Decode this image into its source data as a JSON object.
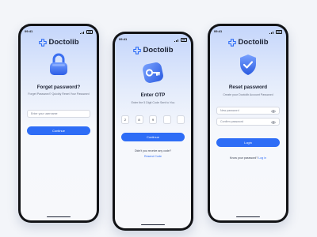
{
  "status_time": "09:41",
  "brand": {
    "name": "Doctolib",
    "color": "#2e6df6"
  },
  "screen_forgot": {
    "illustration": "lock-icon",
    "title": "Forget password?",
    "subtitle": "Forget Password? Quickly Reset Your Password",
    "username_placeholder": "Enter your username",
    "button": "Continue"
  },
  "screen_otp": {
    "illustration": "key-icon",
    "title": "Enter OTP",
    "subtitle": "Enter the 5 Digit Code Sent to You",
    "digits": [
      "2",
      "8",
      "9",
      "",
      ""
    ],
    "button": "Continue",
    "resend_prompt": "Didn't you receive any code?",
    "resend_link": "Resend Code"
  },
  "screen_reset": {
    "illustration": "shield-check-icon",
    "title": "Reset password",
    "subtitle": "Create your Doctolib Account Password",
    "new_password_placeholder": "New password",
    "confirm_password_placeholder": "Confirm password",
    "button": "Login",
    "remember_prompt": "Know your password?",
    "login_link": "Log in"
  },
  "colors": {
    "accent": "#2e6df6",
    "background": "#f3f5f9",
    "phone_frame": "#121316"
  }
}
